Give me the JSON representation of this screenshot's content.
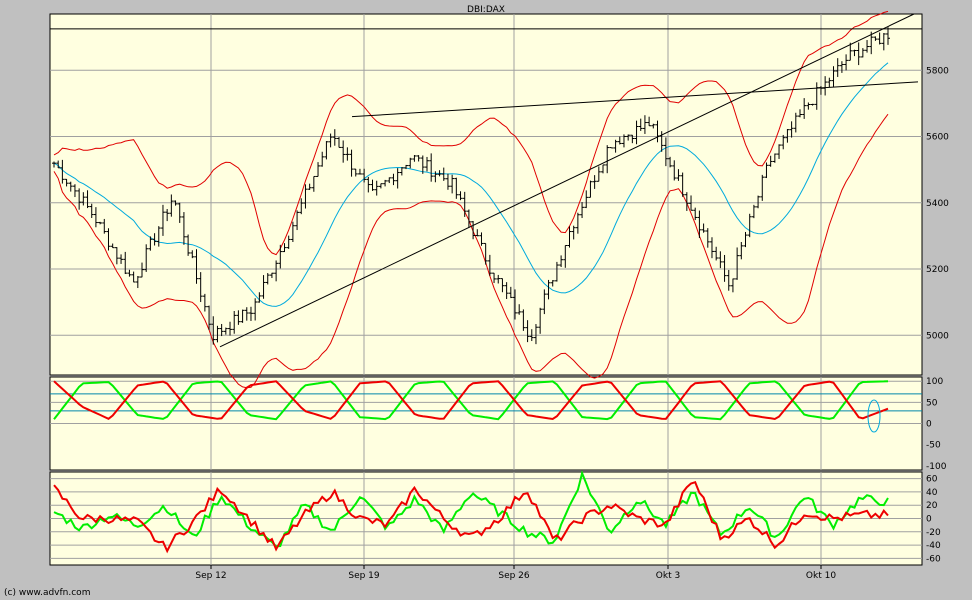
{
  "title": "DBI:DAX",
  "copyright": "(c) www.advfn.com",
  "colors": {
    "background": "#c0c0c0",
    "panel": "#ffffe0",
    "grid": "#a0a0a0",
    "price": "#000000",
    "bollinger_band": "#e00000",
    "bollinger_mid": "#00aadd",
    "oscillator_green": "#00ee00",
    "oscillator_red": "#ee0000",
    "trendline": "#000000"
  },
  "chart_data": [
    {
      "type": "candlestick",
      "panel": "price",
      "title": "DBI:DAX",
      "x_ticks": [
        "Sep 12",
        "Sep 19",
        "Sep 26",
        "Okt 3",
        "Okt 10"
      ],
      "y_ticks": [
        5000,
        5200,
        5400,
        5600,
        5800
      ],
      "ylim": [
        4880,
        5970
      ],
      "grid": true,
      "close_approx": [
        {
          "x": "start",
          "y": 5520
        },
        {
          "x": "Sep 7",
          "y": 5360
        },
        {
          "x": "Sep 8",
          "y": 5160
        },
        {
          "x": "Sep 9",
          "y": 5420
        },
        {
          "x": "Sep 12",
          "y": 5000
        },
        {
          "x": "Sep 13",
          "y": 5080
        },
        {
          "x": "Sep 15",
          "y": 5330
        },
        {
          "x": "Sep 16",
          "y": 5610
        },
        {
          "x": "Sep 19",
          "y": 5420
        },
        {
          "x": "Sep 21",
          "y": 5540
        },
        {
          "x": "Sep 22",
          "y": 5460
        },
        {
          "x": "Sep 23",
          "y": 5200
        },
        {
          "x": "Sep 24",
          "y": 5000
        },
        {
          "x": "Sep 26",
          "y": 5320
        },
        {
          "x": "Sep 28",
          "y": 5580
        },
        {
          "x": "Sep 30",
          "y": 5640
        },
        {
          "x": "Okt 3",
          "y": 5400
        },
        {
          "x": "Okt 5",
          "y": 5150
        },
        {
          "x": "Okt 7",
          "y": 5520
        },
        {
          "x": "Okt 10",
          "y": 5700
        },
        {
          "x": "Okt 12",
          "y": 5840
        },
        {
          "x": "end",
          "y": 5910
        }
      ],
      "overlays": [
        "Bollinger upper band",
        "Bollinger lower band",
        "Bollinger mid line",
        "trendlines"
      ]
    },
    {
      "type": "line",
      "panel": "oscillator-1",
      "y_ticks": [
        100,
        50,
        0,
        -50,
        -100
      ],
      "ylim": [
        -110,
        110
      ],
      "series": [
        {
          "color": "#00ee00",
          "values": [
            10,
            95,
            98,
            20,
            10,
            95,
            100,
            20,
            10,
            90,
            100,
            15,
            10,
            95,
            100,
            20,
            10,
            95,
            100,
            15,
            10,
            95,
            100,
            15,
            10,
            95,
            100,
            20,
            10,
            98,
            100
          ]
        },
        {
          "color": "#ee0000",
          "values": [
            100,
            40,
            10,
            90,
            100,
            20,
            10,
            90,
            100,
            30,
            10,
            95,
            100,
            20,
            10,
            95,
            100,
            20,
            10,
            90,
            100,
            20,
            10,
            95,
            100,
            20,
            10,
            90,
            100,
            10,
            35
          ]
        }
      ]
    },
    {
      "type": "line",
      "panel": "oscillator-2",
      "y_ticks": [
        60,
        40,
        20,
        0,
        -20,
        -40,
        -60
      ],
      "ylim": [
        -70,
        70
      ],
      "series": [
        {
          "color": "#00ee00",
          "values": [
            10,
            -15,
            5,
            -10,
            20,
            -30,
            35,
            -10,
            -45,
            20,
            -20,
            35,
            -15,
            30,
            -20,
            40,
            10,
            -20,
            -35,
            65,
            -20,
            30,
            -10,
            40,
            -25,
            20,
            -30,
            35,
            -10,
            30,
            25
          ]
        },
        {
          "color": "#ee0000",
          "values": [
            45,
            0,
            0,
            -5,
            -45,
            -5,
            45,
            0,
            -45,
            5,
            40,
            0,
            -10,
            45,
            0,
            -30,
            0,
            45,
            -35,
            0,
            20,
            0,
            -10,
            60,
            -30,
            0,
            -40,
            10,
            0,
            5,
            5
          ]
        }
      ]
    }
  ]
}
